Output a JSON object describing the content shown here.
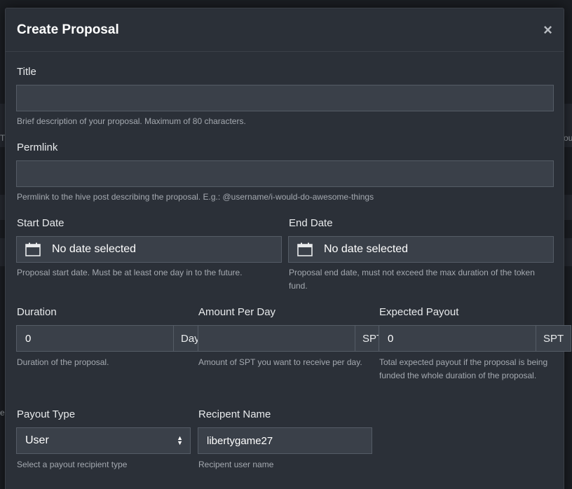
{
  "background": {
    "left_fragment": "T",
    "right_fragment": "ou",
    "left_fragment_2": "e"
  },
  "modal": {
    "title": "Create Proposal",
    "close_symbol": "×"
  },
  "title_field": {
    "label": "Title",
    "value": "",
    "placeholder": "",
    "help": "Brief description of your proposal. Maximum of 80 characters."
  },
  "permlink_field": {
    "label": "Permlink",
    "value": "",
    "placeholder": "",
    "help": "Permlink to the hive post describing the proposal. E.g.: @username/i-would-do-awesome-things"
  },
  "start_date": {
    "label": "Start Date",
    "value": "No date selected",
    "icon": "calendar-icon",
    "help": "Proposal start date. Must be at least one day in to the future."
  },
  "end_date": {
    "label": "End Date",
    "value": "No date selected",
    "icon": "calendar-icon",
    "help": "Proposal end date, must not exceed the max duration of the token fund."
  },
  "duration": {
    "label": "Duration",
    "value": "0",
    "unit": "Days",
    "help": "Duration of the proposal."
  },
  "amount_per_day": {
    "label": "Amount Per Day",
    "value": "",
    "unit": "SPT",
    "help": "Amount of SPT you want to receive per day."
  },
  "expected_payout": {
    "label": "Expected Payout",
    "value": "0",
    "unit": "SPT",
    "help": "Total expected payout if the proposal is being funded the whole duration of the proposal."
  },
  "payout_type": {
    "label": "Payout Type",
    "selected": "User",
    "help": "Select a payout recipient type"
  },
  "recipient_name": {
    "label": "Recipent Name",
    "value": "libertygame27",
    "help": "Recipent user name"
  },
  "colors": {
    "modal_bg": "#2b3038",
    "input_bg": "#3a4049",
    "border": "#555c66",
    "text": "#e8eaec",
    "muted": "#a4a9b0"
  }
}
